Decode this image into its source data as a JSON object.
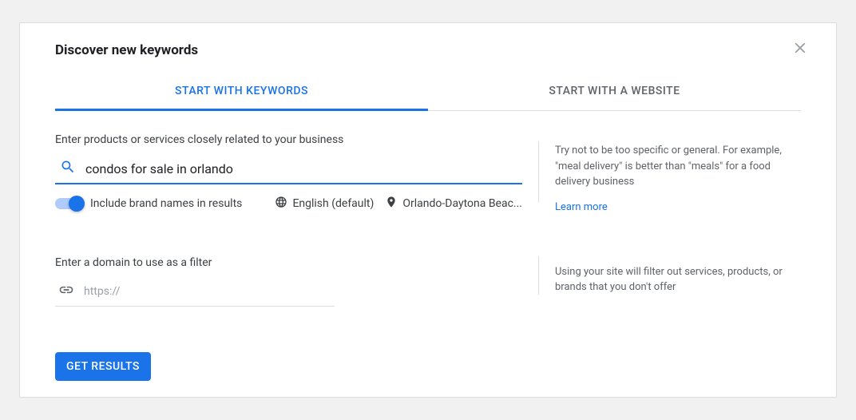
{
  "header": {
    "title": "Discover new keywords"
  },
  "tabs": {
    "keywords": "Start with keywords",
    "website": "Start with a website"
  },
  "keyword_section": {
    "label": "Enter products or services closely related to your business",
    "input_value": "condos for sale in orlando",
    "brand_toggle_label": "Include brand names in results",
    "language": "English (default)",
    "location": "Orlando-Daytona Beac...",
    "hint": "Try not to be too specific or general. For example, \"meal delivery\" is better than \"meals\" for a food delivery business",
    "learn_more": "Learn more"
  },
  "domain_section": {
    "label": "Enter a domain to use as a filter",
    "placeholder": "https://",
    "hint": "Using your site will filter out services, products, or brands that you don't offer"
  },
  "footer": {
    "submit_label": "Get results"
  }
}
